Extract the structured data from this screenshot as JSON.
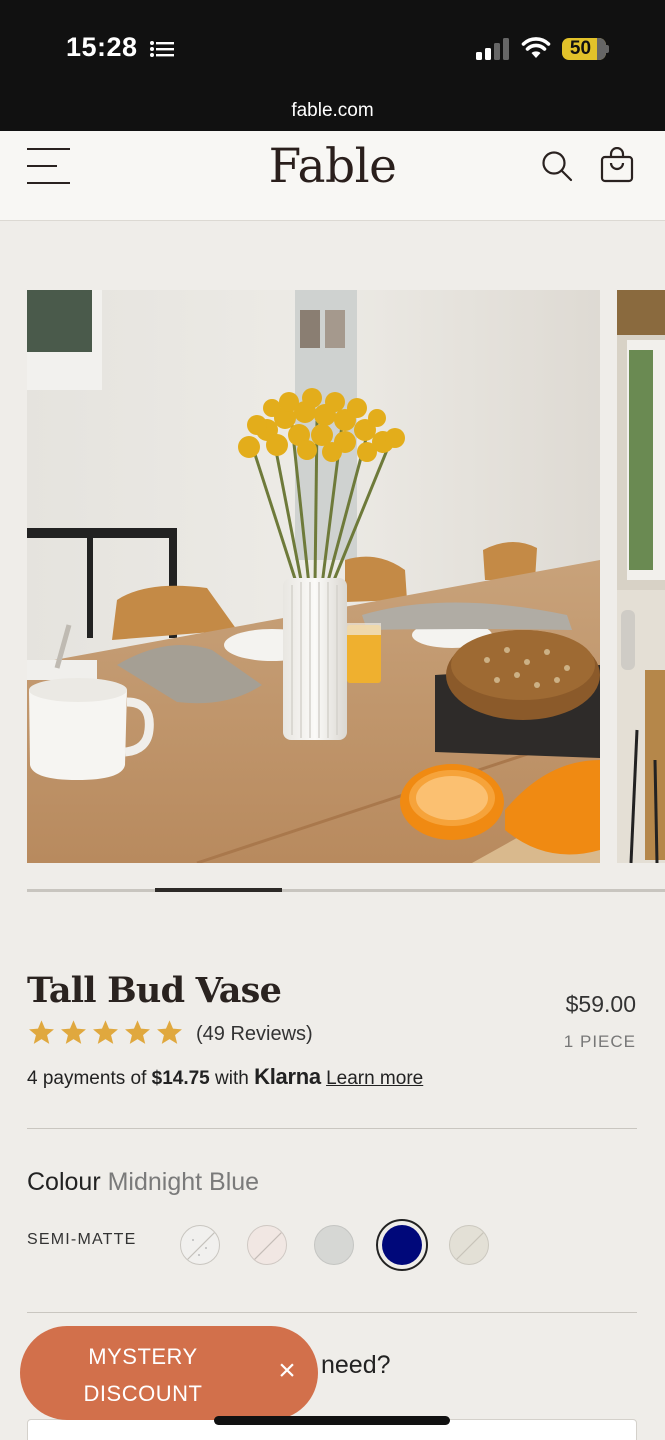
{
  "status_bar": {
    "time": "15:28",
    "battery": "50",
    "icons": [
      "list-icon",
      "signal-icon",
      "wifi-icon",
      "battery-icon"
    ]
  },
  "browser": {
    "url": "fable.com"
  },
  "header": {
    "logo": "Fable",
    "icons": [
      "menu-icon",
      "search-icon",
      "cart-icon"
    ]
  },
  "gallery": {
    "slide_index": 2,
    "slide_count": 5
  },
  "product": {
    "title": "Tall Bud Vase",
    "price": "$59.00",
    "unit": "1 PIECE",
    "rating": 5,
    "reviews": "(49 Reviews)",
    "payments": {
      "prefix": "4 payments of ",
      "amount": "$14.75",
      "middle": " with ",
      "provider": "Klarna",
      "link": "Learn more"
    }
  },
  "colour": {
    "label": "Colour",
    "selected": "Midnight Blue",
    "finish": "SEMI-MATTE",
    "swatches": [
      {
        "name": "speckled-white",
        "color": "#f1f0ee",
        "available": false
      },
      {
        "name": "blush",
        "color": "#f1e7e3",
        "available": false
      },
      {
        "name": "grey",
        "color": "#d6d7d4",
        "available": true
      },
      {
        "name": "midnight-blue",
        "color": "#00087a",
        "available": true,
        "selected": true
      },
      {
        "name": "sand",
        "color": "#e3e0d6",
        "available": false
      }
    ]
  },
  "next_section": {
    "label_partial": "need?"
  },
  "promo": {
    "label_line1": "MYSTERY",
    "label_line2": "DISCOUNT",
    "close": "×",
    "color": "#d2704b"
  },
  "colors": {
    "accent_star": "#e0a83e",
    "background": "#efede9",
    "header_background": "#f8f7f4"
  }
}
